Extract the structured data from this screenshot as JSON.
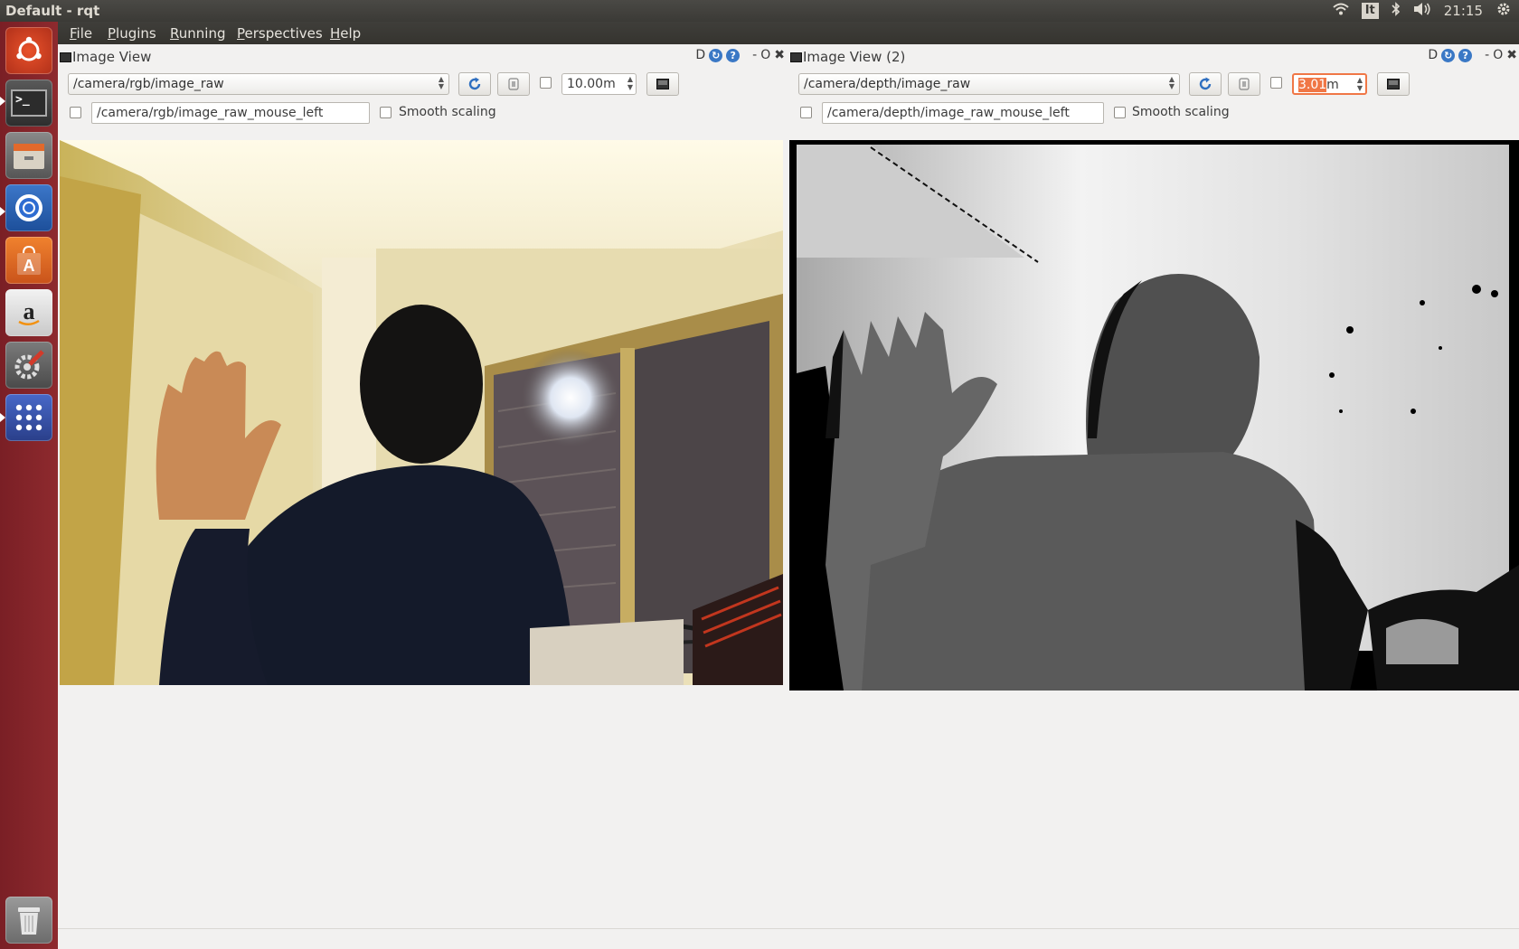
{
  "system": {
    "window_title": "Default - rqt",
    "keyboard_layout": "It",
    "clock": "21:15",
    "tray_icons": [
      "wifi-icon",
      "bluetooth-icon",
      "volume-icon",
      "settings-gear-icon"
    ]
  },
  "launcher": {
    "items": [
      "ubuntu-dash",
      "terminal",
      "file-manager",
      "chromium",
      "software-center",
      "amazon",
      "system-settings",
      "app-grid",
      "trash"
    ]
  },
  "menubar": {
    "items": [
      "File",
      "Plugins",
      "Running",
      "Perspectives",
      "Help"
    ]
  },
  "panels": [
    {
      "title": "Image View",
      "controls": {
        "d": "D",
        "help": "?",
        "minimize": "-",
        "restore": "O",
        "close": "✖"
      },
      "topic": "/camera/rgb/image_raw",
      "max_range": "10.00m",
      "max_range_checked": false,
      "publish_checked": false,
      "mouse_topic": "/camera/rgb/image_raw_mouse_left",
      "smooth_label": "Smooth scaling",
      "smooth_checked": false,
      "image": "rgb-camera-frame"
    },
    {
      "title": "Image View (2)",
      "controls": {
        "d": "D",
        "help": "?",
        "minimize": "-",
        "restore": "O",
        "close": "✖"
      },
      "topic": "/camera/depth/image_raw",
      "max_range_selected": "3.01",
      "max_range_unit": "m",
      "max_range_checked": false,
      "publish_checked": false,
      "mouse_topic": "/camera/depth/image_raw_mouse_left",
      "smooth_label": "Smooth scaling",
      "smooth_checked": false,
      "image": "depth-camera-frame"
    }
  ],
  "colors": {
    "accent": "#f07746",
    "launcher_bg": "#8e2a2e",
    "menubar_bg": "#3b3a36"
  }
}
